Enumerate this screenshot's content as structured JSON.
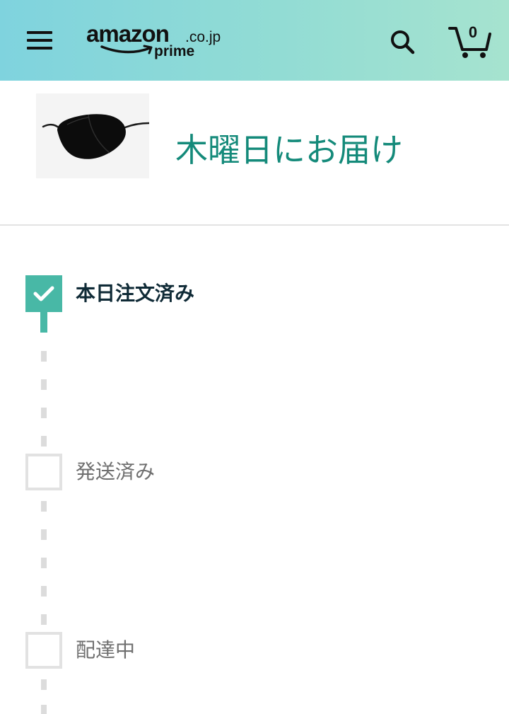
{
  "header": {
    "logo": {
      "wordmark": "amazon",
      "tld": ".co.jp",
      "sub": "prime"
    },
    "cart_count": "0",
    "icons": {
      "menu": "hamburger-menu-icon",
      "search": "search-icon",
      "cart": "cart-icon"
    }
  },
  "shipment": {
    "product_image": "black eye patch",
    "delivery_heading": "木曜日にお届け"
  },
  "tracker": {
    "steps": [
      {
        "label": "本日注文済み",
        "done": true
      },
      {
        "label": "発送済み",
        "done": false
      },
      {
        "label": "配達中",
        "done": false
      }
    ]
  },
  "colors": {
    "header_gradient_start": "#7fd3de",
    "header_gradient_end": "#a6e3cf",
    "accent_teal": "#148a7a",
    "step_done": "#48b8a6",
    "step_pending": "#e2e2e2"
  }
}
